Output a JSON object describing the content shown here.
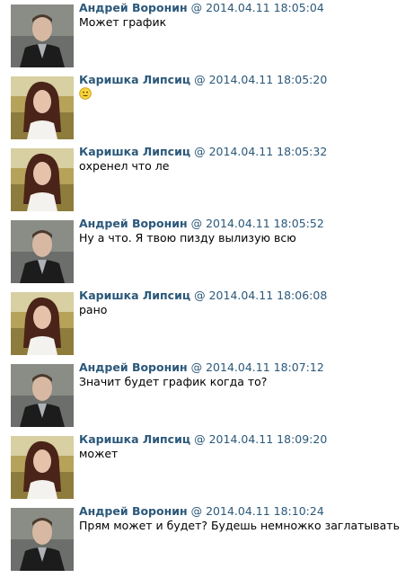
{
  "messages": [
    {
      "author": "Андрей Воронин",
      "at": "@",
      "timestamp": "2014.04.11 18:05:04",
      "text": "Может график",
      "avatar": "male"
    },
    {
      "author": "Каришка Липсиц",
      "at": "@",
      "timestamp": "2014.04.11 18:05:20",
      "text": "",
      "emoji": "neutral-smiley",
      "avatar": "female"
    },
    {
      "author": "Каришка Липсиц",
      "at": "@",
      "timestamp": "2014.04.11 18:05:32",
      "text": "охренел что ле",
      "avatar": "female"
    },
    {
      "author": "Андрей Воронин",
      "at": "@",
      "timestamp": "2014.04.11 18:05:52",
      "text": "Ну а что. Я твою пизду вылизую всю",
      "avatar": "male"
    },
    {
      "author": "Каришка Липсиц",
      "at": "@",
      "timestamp": "2014.04.11 18:06:08",
      "text": "рано",
      "avatar": "female"
    },
    {
      "author": "Андрей Воронин",
      "at": "@",
      "timestamp": "2014.04.11 18:07:12",
      "text": "Значит будет график когда то?",
      "avatar": "male"
    },
    {
      "author": "Каришка Липсиц",
      "at": "@",
      "timestamp": "2014.04.11 18:09:20",
      "text": "может",
      "avatar": "female"
    },
    {
      "author": "Андрей Воронин",
      "at": "@",
      "timestamp": "2014.04.11 18:10:24",
      "text": "Прям может и будет? Будешь немножко заглатывать",
      "avatar": "male"
    }
  ],
  "colors": {
    "author": "#2b587a",
    "timestamp": "#2b587a",
    "text": "#000000"
  }
}
